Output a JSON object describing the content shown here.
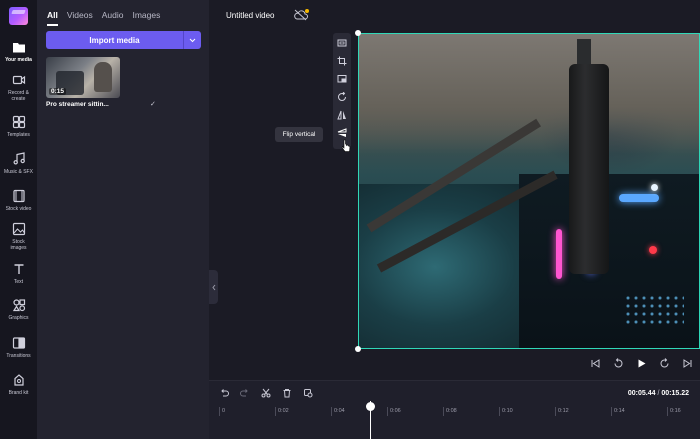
{
  "nav": {
    "items": [
      {
        "label": "Your media",
        "icon": "folder-icon",
        "active": true
      },
      {
        "label": "Record & create",
        "icon": "record-icon"
      },
      {
        "label": "Templates",
        "icon": "templates-icon"
      },
      {
        "label": "Music & SFX",
        "icon": "music-icon"
      },
      {
        "label": "Stock video",
        "icon": "stock-video-icon"
      },
      {
        "label": "Stock images",
        "icon": "stock-images-icon"
      },
      {
        "label": "Text",
        "icon": "text-icon"
      },
      {
        "label": "Graphics",
        "icon": "graphics-icon"
      },
      {
        "label": "Transitions",
        "icon": "transitions-icon"
      },
      {
        "label": "Brand kit",
        "icon": "brand-kit-icon"
      }
    ]
  },
  "media_panel": {
    "tabs": [
      {
        "label": "All",
        "active": true
      },
      {
        "label": "Videos"
      },
      {
        "label": "Audio"
      },
      {
        "label": "Images"
      }
    ],
    "import_label": "Import media",
    "asset": {
      "duration": "0:15",
      "name": "Pro streamer sittin..."
    }
  },
  "header": {
    "project_title": "Untitled video"
  },
  "tooltip": "Flip vertical",
  "timeline": {
    "current": "00:05.44",
    "separator": " / ",
    "total": "00:15.22",
    "ticks": [
      "0",
      "0:02",
      "0:04",
      "0:06",
      "0:08",
      "0:10",
      "0:12",
      "0:14",
      "0:16"
    ]
  },
  "colors": {
    "accent": "#6c5cf0",
    "selection": "#30d8b8"
  }
}
